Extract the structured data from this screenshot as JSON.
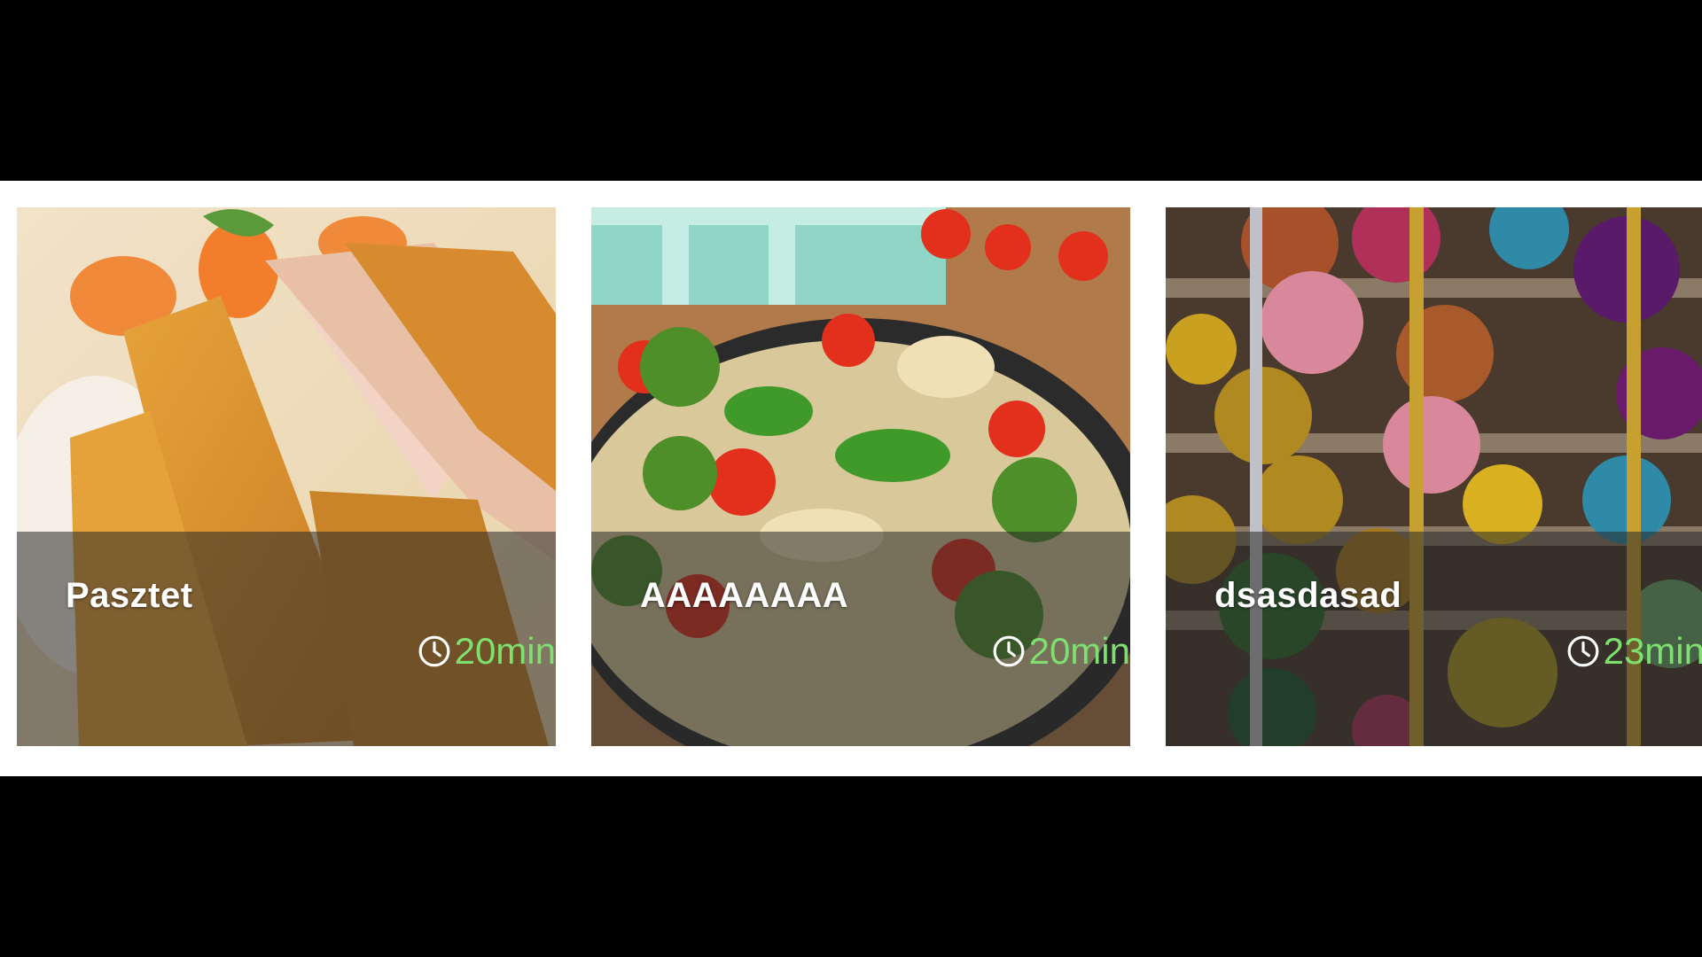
{
  "recipes": [
    {
      "title": "Pasztet",
      "time": "20min",
      "image_icon": "breaded-cutlet-photo"
    },
    {
      "title": "AAAAAAAA",
      "time": "20min",
      "image_icon": "pasta-pan-photo"
    },
    {
      "title": "dsasdasad",
      "time": "23min",
      "image_icon": "christmas-ornaments-photo"
    }
  ],
  "colors": {
    "page_background": "#000000",
    "strip_background": "#ffffff",
    "time_text": "#7ee06e",
    "title_text": "#ffffff"
  }
}
